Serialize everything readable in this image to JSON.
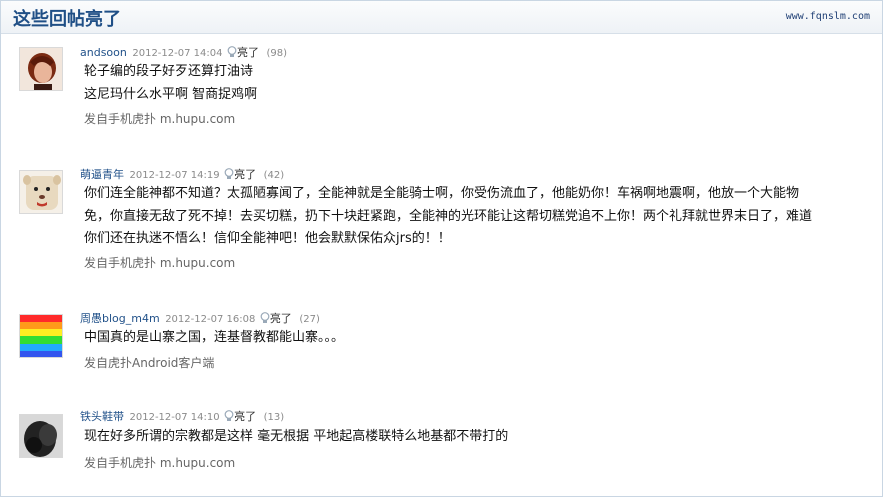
{
  "header": {
    "title": "这些回帖亮了",
    "site": "www.fqnslm.com"
  },
  "posts": [
    {
      "author": "andsoon",
      "time": "2012-12-07 14:04",
      "light_label": "亮了",
      "count": "(98)",
      "lines": [
        "轮子编的段子好歹还算打油诗",
        "这尼玛什么水平啊 智商捉鸡啊"
      ],
      "source": "发自手机虎扑  m.hupu.com"
    },
    {
      "author": "萌逼青年",
      "time": "2012-12-07 14:19",
      "light_label": "亮了",
      "count": "(42)",
      "lines": [
        "你们连全能神都不知道？太孤陋寡闻了，全能神就是全能骑士啊，你受伤流血了，他能奶你！车祸啊地震啊，他放一个大能物",
        "免，你直接无敌了死不掉！去买切糕，扔下十块赶紧跑，全能神的光环能让这帮切糕党追不上你！两个礼拜就世界末日了，难道",
        "你们还在执迷不悟么！信仰全能神吧！他会默默保佑众jrs的！！"
      ],
      "source": "发自手机虎扑  m.hupu.com"
    },
    {
      "author": "周愚blog_m4m",
      "time": "2012-12-07 16:08",
      "light_label": "亮了",
      "count": "(27)",
      "lines": [
        "中国真的是山寨之国，连基督教都能山寨。。。"
      ],
      "source": "发自虎扑Android客户端"
    },
    {
      "author": "铁头鞋带",
      "time": "2012-12-07 14:10",
      "light_label": "亮了",
      "count": "(13)",
      "lines": [
        "现在好多所谓的宗教都是这样  毫无根据  平地起高楼联特么地基都不带打的"
      ],
      "source": "发自手机虎扑  m.hupu.com"
    }
  ]
}
